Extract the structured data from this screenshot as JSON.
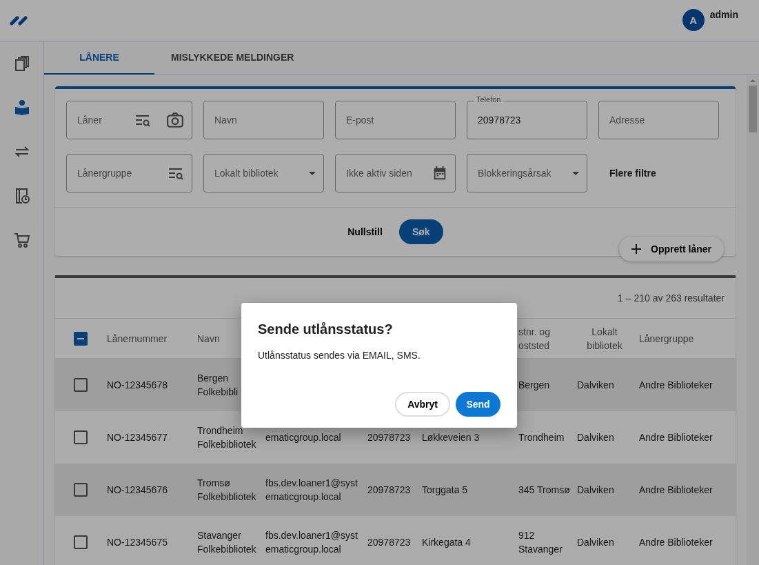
{
  "header": {
    "avatar": "A",
    "user": "admin"
  },
  "sidebar": {
    "items": [
      {
        "kind": "books",
        "selected": false
      },
      {
        "kind": "reader",
        "selected": true
      },
      {
        "kind": "swap",
        "selected": false
      },
      {
        "kind": "book-clock",
        "selected": false
      },
      {
        "kind": "cart",
        "selected": false
      }
    ]
  },
  "tabs": [
    {
      "label": "LÅNERE",
      "selected": true
    },
    {
      "label": "MISLYKKEDE MELDINGER",
      "selected": false
    }
  ],
  "filters": [
    {
      "kind": "lookup-camera",
      "placeholder": "Låner"
    },
    {
      "kind": "text",
      "placeholder": "Navn"
    },
    {
      "kind": "text",
      "placeholder": "E-post"
    },
    {
      "kind": "text",
      "label": "Telefon",
      "value": "20978723"
    },
    {
      "kind": "text",
      "placeholder": "Adresse"
    },
    {
      "kind": "lookup",
      "placeholder": "Lånergruppe"
    },
    {
      "kind": "select",
      "placeholder": "Lokalt bibliotek"
    },
    {
      "kind": "date",
      "placeholder": "Ikke aktiv siden"
    },
    {
      "kind": "select",
      "placeholder": "Blokkeringsårsak"
    },
    {
      "kind": "link",
      "label": "Flere filtre"
    }
  ],
  "actions": {
    "reset": "Nullstill",
    "search": "Søk",
    "create": "Opprett låner"
  },
  "table": {
    "result_count": "1 – 210 av 263 resultater",
    "select_all": {
      "indeterminate": true
    },
    "columns": {
      "number": "Lånernummer",
      "name": "Navn",
      "postal": "stnr. og oststed",
      "library": "Lokalt bibliotek",
      "group": "Lånergruppe"
    },
    "rows": [
      {
        "checked": false,
        "number": "NO-12345678",
        "name": "Bergen Folkebibli",
        "postal": "Bergen",
        "library": "Dalviken",
        "group": "Andre Biblioteker"
      },
      {
        "checked": false,
        "number": "NO-12345677",
        "name": "Trondheim Folkebibliotek",
        "email": "ematicgroup.local",
        "phone": "20978723",
        "address": "Løkkeveien 3",
        "postal": "Trondheim",
        "library": "Dalviken",
        "group": "Andre Biblioteker"
      },
      {
        "checked": false,
        "number": "NO-12345676",
        "name": "Tromsø Folkebibliotek",
        "email": "fbs.dev.loaner1@systematicgroup.local",
        "phone": "20978723",
        "address": "Torggata 5",
        "postal": "345 Tromsø",
        "library": "Dalviken",
        "group": "Andre Biblioteker"
      },
      {
        "checked": false,
        "number": "NO-12345675",
        "name": "Stavanger Folkebibliotek",
        "email": "fbs.dev.loaner1@systematicgroup.local",
        "phone": "20978723",
        "address": "Kirkegata 4",
        "postal": "912 Stavanger",
        "library": "Dalviken",
        "group": "Andre Biblioteker"
      }
    ]
  },
  "dialog": {
    "title": "Sende utlånsstatus?",
    "message": "Utlånsstatus sendes via EMAIL, SMS.",
    "cancel": "Avbryt",
    "confirm": "Send"
  }
}
